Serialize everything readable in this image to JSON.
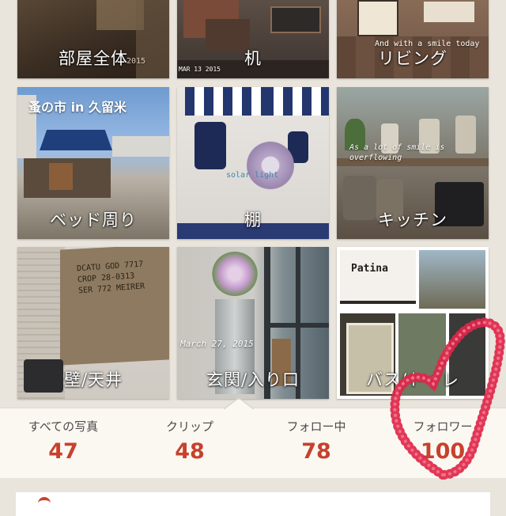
{
  "categories": [
    {
      "label": "部屋全体",
      "photo_text": "2015"
    },
    {
      "label": "机",
      "photo_text": "MAR 13 2015"
    },
    {
      "label": "リビング",
      "photo_text": "And with a smile today"
    },
    {
      "label": "ベッド周り",
      "photo_text": "蚤の市 in 久留米"
    },
    {
      "label": "棚",
      "photo_text": "solar light"
    },
    {
      "label": "キッチン",
      "photo_text": "As a lot of smile is overflowing"
    },
    {
      "label": "壁/天井",
      "photo_text": "DCATU GOD 7717 CROP 28-0313 SER 772 MEIRER"
    },
    {
      "label": "玄関/入り口",
      "photo_text": "March 27, 2015"
    },
    {
      "label": "バス/トイレ",
      "photo_text": "Patina"
    }
  ],
  "stats": [
    {
      "label": "すべての写真",
      "value": "47"
    },
    {
      "label": "クリップ",
      "value": "48"
    },
    {
      "label": "フォロー中",
      "value": "78"
    },
    {
      "label": "フォロワー",
      "value": "100"
    }
  ],
  "colors": {
    "stat_value": "#c8412c",
    "heart_dots": "#e0264a",
    "background": "#e9e4dc"
  }
}
